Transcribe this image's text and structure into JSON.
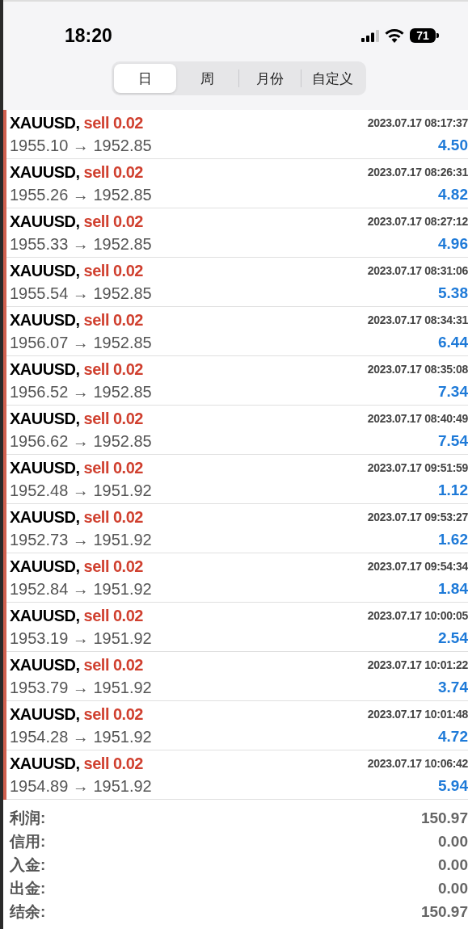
{
  "status_bar": {
    "time": "18:20",
    "battery": "71"
  },
  "tabs": [
    {
      "label": "日",
      "selected": true
    },
    {
      "label": "周",
      "selected": false
    },
    {
      "label": "月份",
      "selected": false
    },
    {
      "label": "自定义",
      "selected": false
    }
  ],
  "deals": [
    {
      "symbol": "XAUUSD,",
      "volume": "0.02",
      "side": "sell",
      "time": "2023.07.17 08:17:37",
      "prices": "1955.10 → 1952.85",
      "profit": "4.50"
    },
    {
      "symbol": "XAUUSD,",
      "volume": "0.02",
      "side": "sell",
      "time": "2023.07.17 08:26:31",
      "prices": "1955.26 → 1952.85",
      "profit": "4.82"
    },
    {
      "symbol": "XAUUSD,",
      "volume": "0.02",
      "side": "sell",
      "time": "2023.07.17 08:27:12",
      "prices": "1955.33 → 1952.85",
      "profit": "4.96"
    },
    {
      "symbol": "XAUUSD,",
      "volume": "0.02",
      "side": "sell",
      "time": "2023.07.17 08:31:06",
      "prices": "1955.54 → 1952.85",
      "profit": "5.38"
    },
    {
      "symbol": "XAUUSD,",
      "volume": "0.02",
      "side": "sell",
      "time": "2023.07.17 08:34:31",
      "prices": "1956.07 → 1952.85",
      "profit": "6.44"
    },
    {
      "symbol": "XAUUSD,",
      "volume": "0.02",
      "side": "sell",
      "time": "2023.07.17 08:35:08",
      "prices": "1956.52 → 1952.85",
      "profit": "7.34"
    },
    {
      "symbol": "XAUUSD,",
      "volume": "0.02",
      "side": "sell",
      "time": "2023.07.17 08:40:49",
      "prices": "1956.62 → 1952.85",
      "profit": "7.54"
    },
    {
      "symbol": "XAUUSD,",
      "volume": "0.02",
      "side": "sell",
      "time": "2023.07.17 09:51:59",
      "prices": "1952.48 → 1951.92",
      "profit": "1.12"
    },
    {
      "symbol": "XAUUSD,",
      "volume": "0.02",
      "side": "sell",
      "time": "2023.07.17 09:53:27",
      "prices": "1952.73 → 1951.92",
      "profit": "1.62"
    },
    {
      "symbol": "XAUUSD,",
      "volume": "0.02",
      "side": "sell",
      "time": "2023.07.17 09:54:34",
      "prices": "1952.84 → 1951.92",
      "profit": "1.84"
    },
    {
      "symbol": "XAUUSD,",
      "volume": "0.02",
      "side": "sell",
      "time": "2023.07.17 10:00:05",
      "prices": "1953.19 → 1951.92",
      "profit": "2.54"
    },
    {
      "symbol": "XAUUSD,",
      "volume": "0.02",
      "side": "sell",
      "time": "2023.07.17 10:01:22",
      "prices": "1953.79 → 1951.92",
      "profit": "3.74"
    },
    {
      "symbol": "XAUUSD,",
      "volume": "0.02",
      "side": "sell",
      "time": "2023.07.17 10:01:48",
      "prices": "1954.28 → 1951.92",
      "profit": "4.72"
    },
    {
      "symbol": "XAUUSD,",
      "volume": "0.02",
      "side": "sell",
      "time": "2023.07.17 10:06:42",
      "prices": "1954.89 → 1951.92",
      "profit": "5.94"
    }
  ],
  "summary": [
    {
      "label": "利润:",
      "value": "150.97"
    },
    {
      "label": "信用:",
      "value": "0.00"
    },
    {
      "label": "入金:",
      "value": "0.00"
    },
    {
      "label": "出金:",
      "value": "0.00"
    },
    {
      "label": "结余:",
      "value": "150.97"
    }
  ]
}
